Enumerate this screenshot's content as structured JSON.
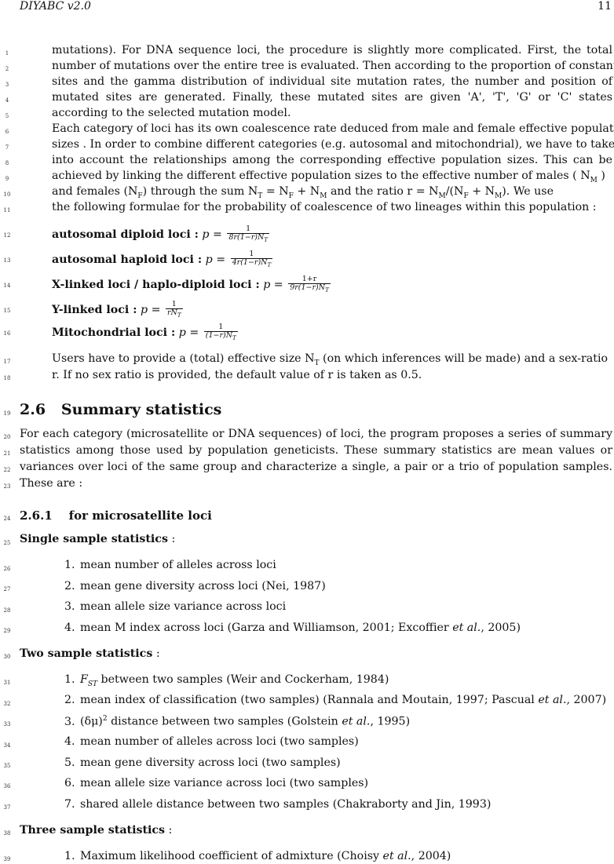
{
  "header": {
    "left": "DIYABC v2.0",
    "right": "11"
  },
  "line_numbers": [
    "1",
    "2",
    "3",
    "4",
    "5",
    "6",
    "7",
    "8",
    "9",
    "10",
    "11",
    "12",
    "13",
    "14",
    "15",
    "16",
    "17",
    "18",
    "19",
    "20",
    "21",
    "22",
    "23",
    "24",
    "25",
    "26",
    "27",
    "28",
    "29",
    "30",
    "31",
    "32",
    "33",
    "34",
    "35",
    "36",
    "37",
    "38",
    "39"
  ],
  "para1": {
    "l1": "mutations). For DNA sequence loci, the procedure is slightly more complicated. First, the total",
    "l2": "number of mutations over the entire tree is evaluated. Then according to the proportion of constant",
    "l3": "sites and the gamma distribution of individual site mutation rates, the number and position of",
    "l4": "mutated sites are generated. Finally, these mutated sites are given 'A', 'T', 'G' or 'C' states",
    "l5": "according to the selected mutation model."
  },
  "para2": {
    "l6": "Each category of loci has its own coalescence rate deduced from male and female effective population",
    "l7": "sizes . In order to combine different categories (e.g. autosomal and mitochondrial), we have to take",
    "l8": "into account the relationships among the corresponding effective population sizes. This can be",
    "l9": "achieved by linking the different effective population sizes to the effective number of males ( N",
    "l9_sub": "M",
    "l9_end": " )",
    "l10_a": "and females (N",
    "l10_sub": "F",
    "l10_b": ") through the sum N",
    "l10_c": " = N",
    "l10_d": " + N",
    "l10_e": " and the ratio r = N",
    "l10_f": "/(N",
    "l10_g": " + N",
    "l10_h": "). We use",
    "l11": "the following formulae for the probability of coalescence of two lineages within this population :"
  },
  "formulas": [
    {
      "label": "autosomal diploid loci :",
      "lhs": "p =",
      "num": "1",
      "den": "8r(1−r)N_T"
    },
    {
      "label": "autosomal haploid loci :",
      "lhs": "p =",
      "num": "1",
      "den": "4r(1−r)N_T"
    },
    {
      "label": "X-linked loci / haplo-diploid loci :",
      "lhs": "p =",
      "num": "1+r",
      "den": "9r(1−r)N_T"
    },
    {
      "label": "Y-linked loci :",
      "lhs": "p =",
      "num": "1",
      "den": "rN_T"
    },
    {
      "label": "Mitochondrial loci :",
      "lhs": "p =",
      "num": "1",
      "den": "(1−r)N_T"
    }
  ],
  "para3": {
    "l17": "Users have to provide a (total) effective size N",
    "l17_b": " (on which inferences will be made) and a sex-ratio",
    "l18": "r. If no sex ratio is provided, the default value of r is taken as 0.5."
  },
  "section": {
    "number": "2.6",
    "title": "Summary statistics"
  },
  "para4": {
    "l20": "For each category (microsatellite or DNA sequences) of loci, the program proposes a series of summary",
    "l21": "statistics among those used by population geneticists. These summary statistics are mean values or",
    "l22": "variances over loci of the same group and characterize a single, a pair or a trio of population samples.",
    "l23": "These are :"
  },
  "subsection": {
    "number": "2.6.1",
    "title": "for microsatellite loci"
  },
  "single": {
    "heading": "Single sample statistics",
    "colon": " :",
    "items": [
      "mean number of alleles across loci",
      "mean gene diversity across loci (Nei, 1987)",
      "mean allele size variance across loci",
      "mean M index across loci (Garza and Williamson, 2001; Excoffier "
    ],
    "item4_etal": "et al.",
    "item4_end": ", 2005)"
  },
  "two": {
    "heading": "Two sample statistics",
    "colon": " :",
    "i1_a": "F",
    "i1_sub": "ST",
    "i1_b": " between two samples (Weir and Cockerham, 1984)",
    "i2_a": "mean index of classification (two samples) (Rannala and Moutain, 1997; Pascual ",
    "i2_etal": "et al.",
    "i2_b": ", 2007)",
    "i3_a": "(δμ)",
    "i3_sup": "2",
    "i3_b": " distance between two samples (Golstein ",
    "i3_etal": "et al.",
    "i3_c": ", 1995)",
    "i4": "mean number of alleles across loci (two samples)",
    "i5": "mean gene diversity across loci (two samples)",
    "i6": "mean allele size variance across loci (two samples)",
    "i7": "shared allele distance between two samples (Chakraborty and Jin, 1993)"
  },
  "three": {
    "heading": "Three sample statistics",
    "colon": " :",
    "i1_a": "Maximum likelihood coefficient of admixture (Choisy ",
    "i1_etal": "et al.",
    "i1_b": ", 2004)"
  },
  "item_numbers": [
    "1.",
    "2.",
    "3.",
    "4.",
    "5.",
    "6.",
    "7."
  ]
}
